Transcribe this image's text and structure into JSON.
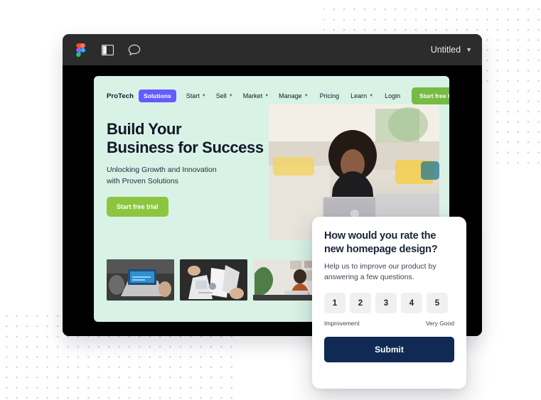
{
  "window": {
    "title": "Untitled",
    "chevron": "chevron-down-icon",
    "toolbar_icons": [
      "figma-logo-icon",
      "panel-toggle-icon",
      "comment-bubble-icon"
    ]
  },
  "site": {
    "brand": "ProTech",
    "active_pill": "Solutions",
    "nav_left": [
      {
        "label": "Start",
        "caret": true
      },
      {
        "label": "Sell",
        "caret": true
      },
      {
        "label": "Market",
        "caret": true
      },
      {
        "label": "Manage",
        "caret": true
      }
    ],
    "nav_right": [
      {
        "label": "Pricing",
        "caret": false
      },
      {
        "label": "Learn",
        "caret": true
      },
      {
        "label": "Login",
        "caret": false
      }
    ],
    "nav_cta": "Start free trial",
    "hero_heading_line1": "Build Your",
    "hero_heading_line2": "Business for Success",
    "hero_sub_line1": "Unlocking Growth and Innovation",
    "hero_sub_line2": "with Proven Solutions",
    "hero_cta": "Start free trial",
    "hero_photo_alt": "woman-working-on-laptop-photo",
    "thumbnails": [
      "person-typing-on-laptop-photo",
      "hands-holding-documents-photo",
      "man-at-desk-with-laptop-photo"
    ]
  },
  "feedback_card": {
    "title_line1": "How would you rate the",
    "title_line2": "new homepage design?",
    "subtitle_line1": "Help us to improve our product by",
    "subtitle_line2": "answering a few questions.",
    "ratings": [
      "1",
      "2",
      "3",
      "4",
      "5"
    ],
    "label_low": "Improvement",
    "label_high": "Very Good",
    "submit_label": "Submit"
  },
  "colors": {
    "window_chrome": "#2c2c2c",
    "canvas": "#000000",
    "site_background": "#d9f2e6",
    "accent_purple": "#635bff",
    "accent_green": "#8cc63f",
    "submit_navy": "#102a54",
    "dot_grid": "#c9d6e6"
  }
}
